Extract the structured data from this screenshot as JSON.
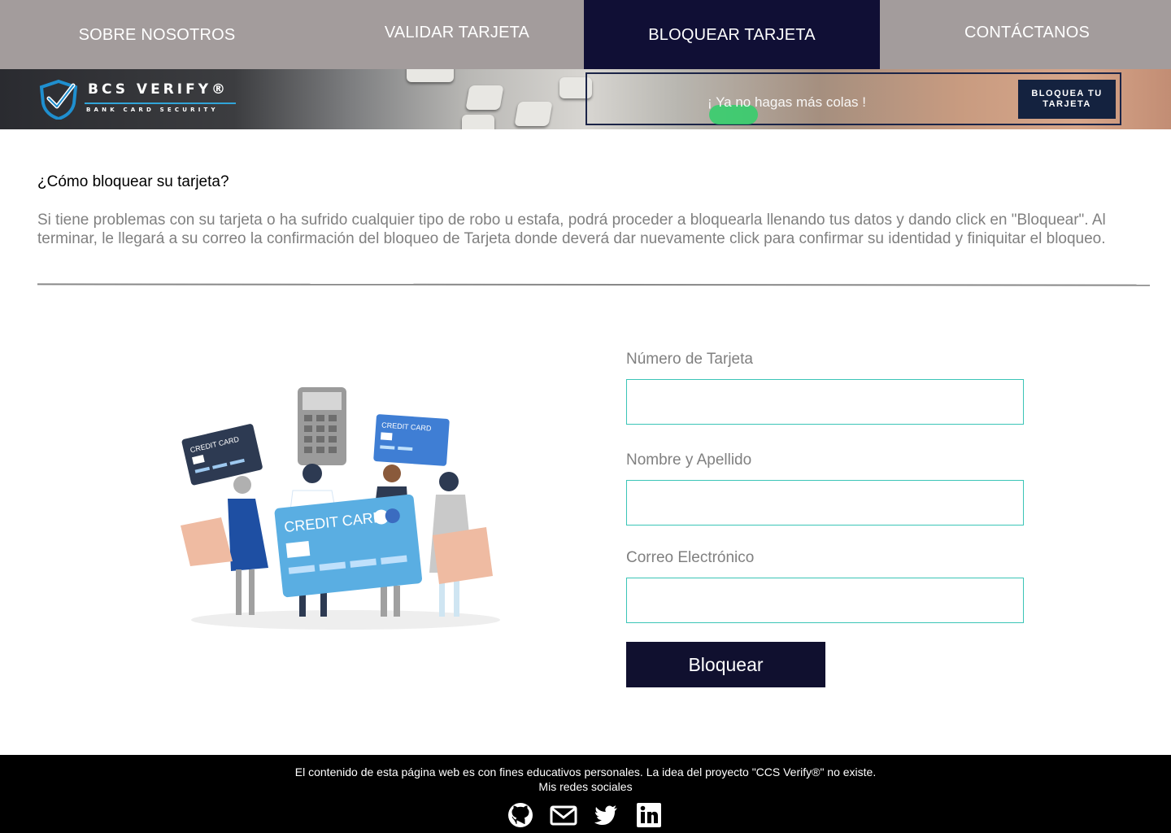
{
  "nav": {
    "items": [
      {
        "label": "SOBRE NOSOTROS",
        "active": false
      },
      {
        "label": "VALIDAR TARJETA",
        "active": false
      },
      {
        "label": "BLOQUEAR TARJETA",
        "active": true
      },
      {
        "label": "CONTÁCTANOS",
        "active": false
      }
    ],
    "colors": {
      "bar": "#a39c9c",
      "active": "#100f35"
    }
  },
  "banner": {
    "logo_title": "BCS VERIFY®",
    "logo_subtitle": "BANK CARD SECURITY",
    "slogan": "¡ Ya no hagas más colas !",
    "cta_label": "BLOQUEA TU TARJETA"
  },
  "main": {
    "title": "¿Cómo bloquear su tarjeta?",
    "description": "Si tiene problemas con su tarjeta o ha sufrido cualquier tipo de robo u estafa, podrá proceder a bloquearla llenando tus datos y dando click en \"Bloquear\". Al terminar, le llegará a su correo la confirmación del bloqueo de Tarjeta donde deverá dar nuevamente click para confirmar su identidad y finiquitar el bloqueo.",
    "illustration": {
      "card_small_left": "CREDIT CARD",
      "card_small_right": "CREDIT CARD",
      "card_big": "CREDIT CARD"
    }
  },
  "form": {
    "card_number_label": "Número de Tarjeta",
    "card_number_value": "",
    "name_label": "Nombre y Apellido",
    "name_value": "",
    "email_label": "Correo Electrónico",
    "email_value": "",
    "submit_label": "Bloquear",
    "colors": {
      "input_border": "#3bc5b7",
      "button": "#10102f"
    }
  },
  "footer": {
    "disclaimer": "El contenido de esta página web es con fines educativos personales. La idea del proyecto \"CCS Verify®\" no existe.",
    "social_title": "Mis redes sociales",
    "icons": [
      "github-icon",
      "mail-icon",
      "twitter-icon",
      "linkedin-icon"
    ]
  }
}
